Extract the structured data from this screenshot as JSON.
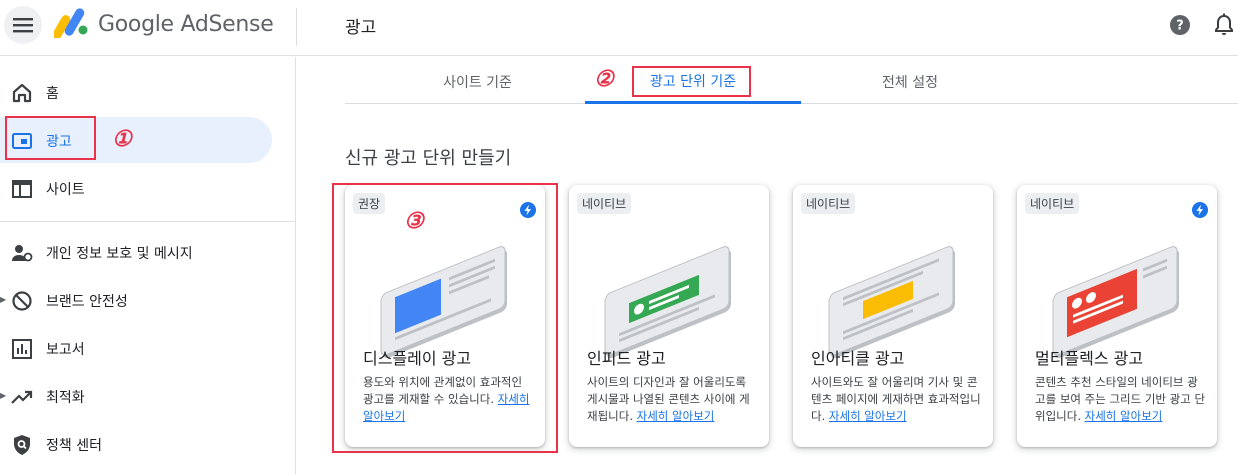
{
  "header": {
    "brand": "Google AdSense",
    "title": "광고"
  },
  "sidebar": {
    "items": [
      {
        "label": "홈",
        "icon": "home-icon"
      },
      {
        "label": "광고",
        "icon": "ads-icon",
        "active": true
      },
      {
        "label": "사이트",
        "icon": "sites-icon"
      },
      {
        "label": "개인 정보 보호 및 메시지",
        "icon": "privacy-icon"
      },
      {
        "label": "브랜드 안전성",
        "icon": "block-icon"
      },
      {
        "label": "보고서",
        "icon": "reports-icon"
      },
      {
        "label": "최적화",
        "icon": "trending-icon"
      },
      {
        "label": "정책 센터",
        "icon": "policy-icon"
      }
    ]
  },
  "tabs": [
    {
      "label": "사이트 기준"
    },
    {
      "label": "광고 단위 기준",
      "active": true
    },
    {
      "label": "전체 설정"
    }
  ],
  "section": {
    "title": "신규 광고 단위 만들기"
  },
  "cards": [
    {
      "badge": "권장",
      "title": "디스플레이 광고",
      "desc": "용도와 위치에 관계없이 효과적인 광고를 게재할 수 있습니다.",
      "link": "자세히 알아보기",
      "accent": "#4285f4"
    },
    {
      "badge": "네이티브",
      "title": "인피드 광고",
      "desc": "사이트의 디자인과 잘 어울리도록 게시물과 나열된 콘텐츠 사이에 게재됩니다.",
      "link": "자세히 알아보기",
      "accent": "#34a853"
    },
    {
      "badge": "네이티브",
      "title": "인아티클 광고",
      "desc": "사이트와도 잘 어울리며 기사 및 콘텐츠 페이지에 게재하면 효과적입니다.",
      "link": "자세히 알아보기",
      "accent": "#fbbc04"
    },
    {
      "badge": "네이티브",
      "title": "멀티플렉스 광고",
      "desc": "콘텐츠 추천 스타일의 네이티브 광고를 보여 주는 그리드 기반 광고 단위입니다.",
      "link": "자세히 알아보기",
      "accent": "#ea4335"
    }
  ],
  "annotations": [
    "①",
    "②",
    "③"
  ]
}
